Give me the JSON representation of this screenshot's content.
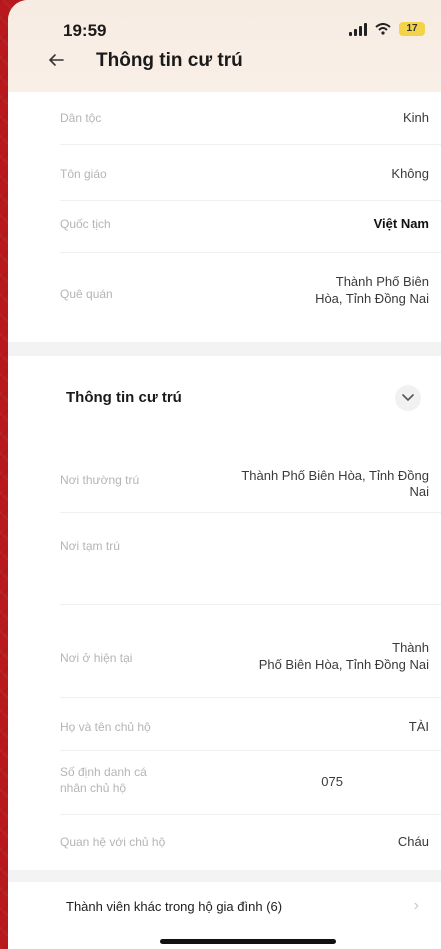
{
  "status_bar": {
    "time": "19:59",
    "battery": "17"
  },
  "header": {
    "title": "Thông tin cư trú"
  },
  "personal_info": [
    {
      "label": "Dân tộc",
      "value": "Kinh"
    },
    {
      "label": "Tôn giáo",
      "value": "Không"
    },
    {
      "label": "Quốc tịch",
      "value": "Việt Nam"
    },
    {
      "label": "Quê quán",
      "value_line1": "Thành Phố Biên",
      "value_line2": "Hòa, Tỉnh Đồng Nai"
    }
  ],
  "residence_section": {
    "title": "Thông tin cư trú",
    "rows": [
      {
        "label": "Nơi thường trú",
        "value_line1": "Thành Phố Biên Hòa, Tỉnh Đồng",
        "value_line2": "Nai"
      },
      {
        "label": "Nơi tạm trú",
        "value": ""
      },
      {
        "label": "Nơi ở hiện tại",
        "value_line1": "Thành",
        "value_line2": "Phố Biên Hòa, Tỉnh Đồng Nai"
      },
      {
        "label": "Họ và tên chủ hộ",
        "value": "TÀI"
      },
      {
        "label_line1": "Số định danh cá",
        "label_line2": "nhân chủ hộ",
        "value": "075"
      },
      {
        "label": "Quan hệ với chủ hộ",
        "value": "Cháu"
      }
    ]
  },
  "household_members": {
    "label": "Thành viên khác trong hộ gia đình (6)"
  }
}
